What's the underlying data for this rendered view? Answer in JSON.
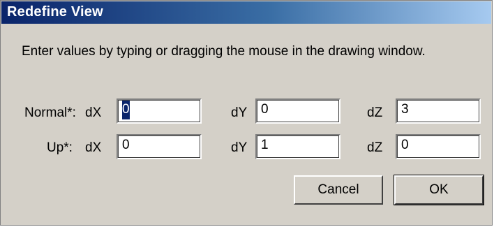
{
  "dialog": {
    "title": "Redefine View",
    "instructions": "Enter values by typing or dragging the mouse in the drawing window."
  },
  "normal": {
    "row_label": "Normal*:",
    "dx_label": "dX",
    "dx_value": "0",
    "dy_label": "dY",
    "dy_value": "0",
    "dz_label": "dZ",
    "dz_value": "3"
  },
  "up": {
    "row_label": "Up*:",
    "dx_label": "dX",
    "dx_value": "0",
    "dy_label": "dY",
    "dy_value": "1",
    "dz_label": "dZ",
    "dz_value": "0"
  },
  "buttons": {
    "cancel_label": "Cancel",
    "ok_label": "OK"
  },
  "colors": {
    "titlebar_start": "#0a246a",
    "titlebar_end": "#a6caf0",
    "dialog_face": "#d4d0c8",
    "selection": "#0a246a"
  }
}
